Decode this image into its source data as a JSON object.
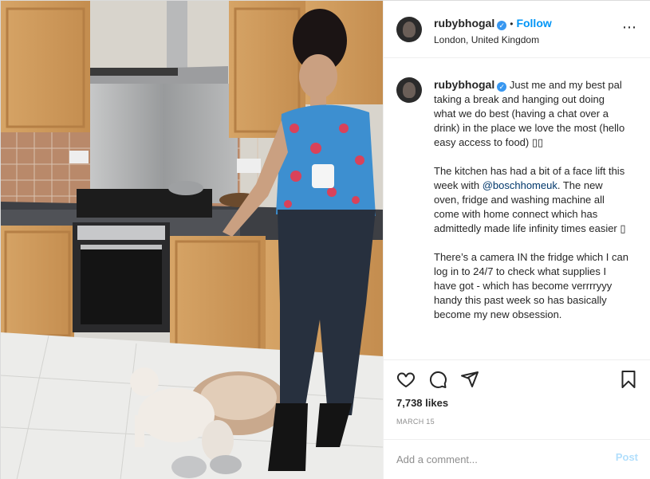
{
  "post": {
    "username": "ruby​bhogal",
    "verified_mark": "✓",
    "dot": "•",
    "follow_label": "Follow",
    "location": "London, United Kingdom",
    "more_icon": "⋯",
    "caption": {
      "lead": "Just me and my best pal taking a break and hanging out doing what we do best (having a chat over a drink) in the place we love the most (hello easy access to food) ▯▯",
      "p2_before": "The kitchen has had a bit of a face lift this week with ",
      "p2_mention": "@boschhomeuk",
      "p2_after": ". The new oven, fridge and washing machine all come with home connect which has admittedly made life infinity times easier ▯",
      "p3": "There’s a camera IN the fridge which I can log in to 24/7 to check what supplies I have got - which has become verrrryyy handy this past week so has basically become my new obsession."
    },
    "likes": "7,738 likes",
    "date": "MARCH 15",
    "comment_placeholder": "Add a comment...",
    "post_label": "Post"
  },
  "icons": {
    "like": "heart-icon",
    "comment": "comment-icon",
    "share": "share-icon",
    "save": "bookmark-icon"
  },
  "colors": {
    "accent": "#0095f6",
    "verified": "#3897f0",
    "mention": "#00376b",
    "muted": "#8e8e8e",
    "post_disabled": "#b2dffc"
  }
}
